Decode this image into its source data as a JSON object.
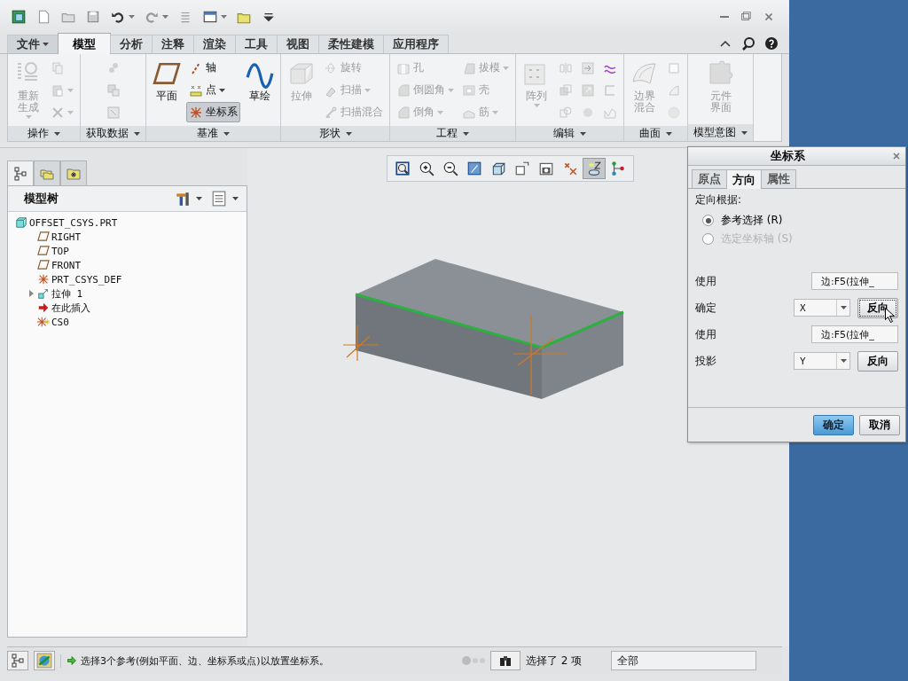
{
  "quick_access": [
    {
      "dropdown": false
    },
    {
      "dropdown": false
    },
    {
      "dropdown": false
    },
    {
      "dropdown": false
    },
    {
      "dropdown": true
    },
    {
      "dropdown": true
    },
    {
      "dropdown": false
    },
    {
      "dropdown": true
    },
    {
      "dropdown": false
    },
    {
      "dropdown": false
    }
  ],
  "menu_tabs": [
    {
      "label": "文件",
      "kind": "menu",
      "selected": false
    },
    {
      "label": "模型",
      "kind": "tab",
      "selected": true
    },
    {
      "label": "分析",
      "kind": "tab",
      "selected": false
    },
    {
      "label": "注释",
      "kind": "tab",
      "selected": false
    },
    {
      "label": "渲染",
      "kind": "tab",
      "selected": false
    },
    {
      "label": "工具",
      "kind": "tab",
      "selected": false
    },
    {
      "label": "视图",
      "kind": "tab",
      "selected": false
    },
    {
      "label": "柔性建模",
      "kind": "tab",
      "selected": false
    },
    {
      "label": "应用程序",
      "kind": "tab",
      "selected": false
    }
  ],
  "ribbon": {
    "groups": [
      {
        "label": "操作",
        "columns": [
          [
            {
              "label": "重新生成",
              "kind": "large",
              "dropdown": true,
              "disabled": true,
              "selected": false
            }
          ],
          [
            {
              "kind": "small",
              "dropdown": false,
              "disabled": true,
              "selected": false
            },
            {
              "kind": "small",
              "dropdown": true,
              "disabled": true,
              "selected": false
            },
            {
              "kind": "small",
              "dropdown": true,
              "disabled": true,
              "selected": false
            }
          ]
        ]
      },
      {
        "label": "获取数据",
        "columns": [
          [
            {
              "kind": "small",
              "dropdown": false,
              "disabled": true,
              "selected": false
            },
            {
              "kind": "small",
              "dropdown": false,
              "disabled": true,
              "selected": false
            },
            {
              "kind": "small",
              "dropdown": false,
              "disabled": true,
              "selected": false
            }
          ]
        ]
      },
      {
        "label": "基准",
        "columns": [
          [
            {
              "label": "平面",
              "kind": "large",
              "dropdown": false,
              "disabled": false,
              "selected": false
            }
          ],
          [
            {
              "label": "轴",
              "kind": "small",
              "dropdown": false,
              "disabled": false,
              "selected": false
            },
            {
              "label": "点",
              "kind": "small",
              "dropdown": true,
              "disabled": false,
              "selected": false
            },
            {
              "label": "坐标系",
              "kind": "small",
              "dropdown": false,
              "disabled": false,
              "selected": true
            }
          ],
          [
            {
              "label": "草绘",
              "kind": "large",
              "dropdown": false,
              "disabled": false,
              "selected": false
            }
          ]
        ]
      },
      {
        "label": "形状",
        "columns": [
          [
            {
              "label": "拉伸",
              "kind": "large",
              "dropdown": false,
              "disabled": true,
              "selected": false
            }
          ],
          [
            {
              "label": "旋转",
              "kind": "small",
              "dropdown": false,
              "disabled": true,
              "selected": false
            },
            {
              "label": "扫描",
              "kind": "small",
              "dropdown": true,
              "disabled": true,
              "selected": false
            },
            {
              "label": "扫描混合",
              "kind": "small",
              "dropdown": false,
              "disabled": true,
              "selected": false
            }
          ]
        ]
      },
      {
        "label": "工程",
        "columns": [
          [
            {
              "label": "孔",
              "kind": "small",
              "dropdown": false,
              "disabled": true,
              "selected": false
            },
            {
              "label": "倒圆角",
              "kind": "small",
              "dropdown": true,
              "disabled": true,
              "selected": false
            },
            {
              "label": "倒角",
              "kind": "small",
              "dropdown": true,
              "disabled": true,
              "selected": false
            }
          ],
          [
            {
              "label": "拔模",
              "kind": "small",
              "dropdown": true,
              "disabled": true,
              "selected": false
            },
            {
              "label": "壳",
              "kind": "small",
              "dropdown": false,
              "disabled": true,
              "selected": false
            },
            {
              "label": "筋",
              "kind": "small",
              "dropdown": true,
              "disabled": true,
              "selected": false
            }
          ]
        ]
      },
      {
        "label": "编辑",
        "columns": [
          [
            {
              "label": "阵列",
              "kind": "large",
              "dropdown": true,
              "disabled": true,
              "selected": false
            }
          ],
          [
            {
              "kind": "small",
              "dropdown": false,
              "disabled": true,
              "selected": false
            },
            {
              "kind": "small",
              "dropdown": false,
              "disabled": true,
              "selected": false
            },
            {
              "kind": "small",
              "dropdown": false,
              "disabled": true,
              "selected": false
            }
          ],
          [
            {
              "kind": "small",
              "dropdown": false,
              "disabled": true,
              "selected": false
            },
            {
              "kind": "small",
              "dropdown": false,
              "disabled": true,
              "selected": false
            },
            {
              "kind": "small",
              "dropdown": false,
              "disabled": true,
              "selected": false
            }
          ],
          [
            {
              "kind": "small",
              "dropdown": false,
              "disabled": false,
              "selected": false
            },
            {
              "kind": "small",
              "dropdown": false,
              "disabled": true,
              "selected": false
            },
            {
              "kind": "small",
              "dropdown": false,
              "disabled": true,
              "selected": false
            }
          ]
        ]
      },
      {
        "label": "曲面",
        "columns": [
          [
            {
              "label": "边界混合",
              "kind": "large",
              "dropdown": false,
              "disabled": true,
              "selected": false
            }
          ],
          [
            {
              "kind": "small",
              "dropdown": false,
              "disabled": true,
              "selected": false
            },
            {
              "kind": "small",
              "dropdown": false,
              "disabled": true,
              "selected": false
            },
            {
              "kind": "small",
              "dropdown": false,
              "disabled": true,
              "selected": false
            }
          ]
        ]
      },
      {
        "label": "模型意图",
        "columns": [
          [
            {
              "label": "元件界面",
              "kind": "large",
              "dropdown": false,
              "disabled": true,
              "selected": false
            }
          ]
        ]
      }
    ]
  },
  "view_toolbar": [
    {
      "selected": false
    },
    {
      "selected": false
    },
    {
      "selected": false
    },
    {
      "selected": false
    },
    {
      "selected": false
    },
    {
      "selected": false
    },
    {
      "selected": false
    },
    {
      "selected": false
    },
    {
      "selected": true
    },
    {
      "selected": false
    }
  ],
  "navigator": {
    "tabs": [
      {
        "selected": true
      },
      {
        "selected": false
      },
      {
        "selected": false
      }
    ],
    "title": "模型树",
    "tree": [
      {
        "label": "OFFSET_CSYS.PRT",
        "kind": "part",
        "children": [
          {
            "label": "RIGHT",
            "kind": "plane"
          },
          {
            "label": "TOP",
            "kind": "plane"
          },
          {
            "label": "FRONT",
            "kind": "plane"
          },
          {
            "label": "PRT_CSYS_DEF",
            "kind": "csys"
          },
          {
            "label": "拉伸 1",
            "kind": "feature",
            "expanded": false
          },
          {
            "label": "在此插入",
            "kind": "insert"
          },
          {
            "label": "CS0",
            "kind": "newcsys"
          }
        ]
      }
    ]
  },
  "dialog": {
    "title": "坐标系",
    "tabs": [
      {
        "label": "原点",
        "selected": false
      },
      {
        "label": "方向",
        "selected": true
      },
      {
        "label": "属性",
        "selected": false
      }
    ],
    "orient_label": "定向根据:",
    "radios": [
      {
        "label": "参考选择 (R)",
        "selected": true,
        "disabled": false
      },
      {
        "label": "选定坐标轴 (S)",
        "selected": false,
        "disabled": true
      }
    ],
    "rows": [
      {
        "kind": "field",
        "label": "使用",
        "value": "边:F5(拉伸_"
      },
      {
        "kind": "axis",
        "label": "确定",
        "value": "X",
        "button": "反向"
      },
      {
        "kind": "field",
        "label": "使用",
        "value": "边:F5(拉伸_"
      },
      {
        "kind": "axis",
        "label": "投影",
        "value": "Y",
        "button": "反向"
      }
    ],
    "buttons": [
      {
        "label": "确定",
        "kind": "default"
      },
      {
        "label": "取消",
        "kind": "normal"
      }
    ]
  },
  "status_bar": {
    "message": "选择3个参考(例如平面、边、坐标系或点)以放置坐标系。",
    "selection": "选择了 2 项",
    "filter": "全部"
  }
}
